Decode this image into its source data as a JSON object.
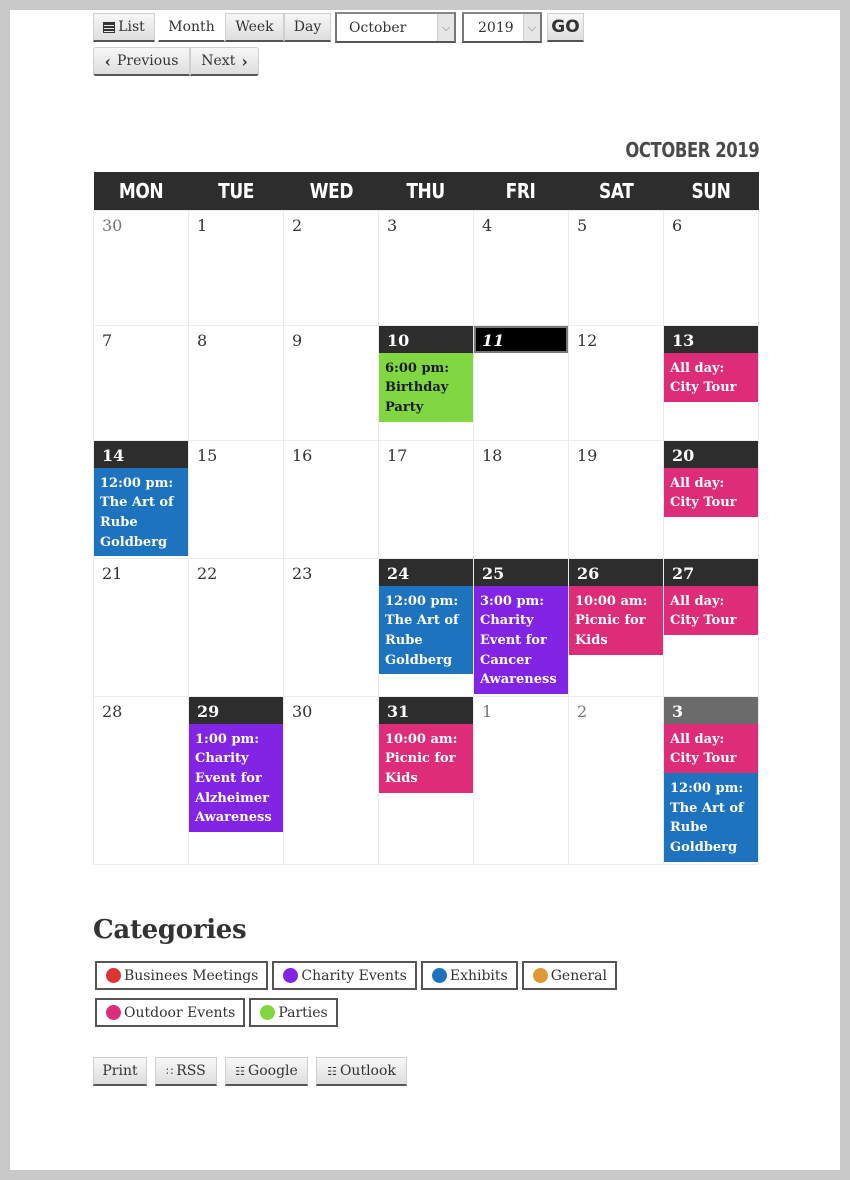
{
  "toolbar": {
    "views": [
      {
        "label": "List",
        "icon": "list-icon",
        "active": false
      },
      {
        "label": "Month",
        "active": true
      },
      {
        "label": "Week",
        "active": false
      },
      {
        "label": "Day",
        "active": false
      }
    ],
    "month_select": {
      "value": "October"
    },
    "year_select": {
      "value": "2019"
    },
    "go_label": "GO",
    "previous_label": "Previous",
    "next_label": "Next",
    "previous_icon": "‹",
    "next_icon": "›"
  },
  "calendar": {
    "title": "OCTOBER 2019",
    "weekdays": [
      "MON",
      "TUE",
      "WED",
      "THU",
      "FRI",
      "SAT",
      "SUN"
    ],
    "today": "11",
    "weeks": [
      [
        {
          "day": "30",
          "other": true,
          "events": []
        },
        {
          "day": "1",
          "events": []
        },
        {
          "day": "2",
          "events": []
        },
        {
          "day": "3",
          "events": []
        },
        {
          "day": "4",
          "events": []
        },
        {
          "day": "5",
          "events": []
        },
        {
          "day": "6",
          "events": []
        }
      ],
      [
        {
          "day": "7",
          "events": []
        },
        {
          "day": "8",
          "events": []
        },
        {
          "day": "9",
          "events": []
        },
        {
          "day": "10",
          "events": [
            {
              "text": "6:00 pm: Birthday Party",
              "category": "parties"
            }
          ]
        },
        {
          "day": "11",
          "today": true,
          "events": []
        },
        {
          "day": "12",
          "events": []
        },
        {
          "day": "13",
          "events": [
            {
              "text": "All day: City Tour",
              "category": "outdoor"
            }
          ]
        }
      ],
      [
        {
          "day": "14",
          "events": [
            {
              "text": "12:00 pm: The Art of Rube Goldberg",
              "category": "exhibits"
            }
          ]
        },
        {
          "day": "15",
          "events": []
        },
        {
          "day": "16",
          "events": []
        },
        {
          "day": "17",
          "events": []
        },
        {
          "day": "18",
          "events": []
        },
        {
          "day": "19",
          "events": []
        },
        {
          "day": "20",
          "events": [
            {
              "text": "All day: City Tour",
              "category": "outdoor"
            }
          ]
        }
      ],
      [
        {
          "day": "21",
          "events": []
        },
        {
          "day": "22",
          "events": []
        },
        {
          "day": "23",
          "events": []
        },
        {
          "day": "24",
          "events": [
            {
              "text": "12:00 pm: The Art of Rube Goldberg",
              "category": "exhibits"
            }
          ]
        },
        {
          "day": "25",
          "events": [
            {
              "text": "3:00 pm: Charity Event for Cancer Awareness",
              "category": "charity"
            }
          ]
        },
        {
          "day": "26",
          "events": [
            {
              "text": "10:00 am: Picnic for Kids",
              "category": "outdoor"
            }
          ]
        },
        {
          "day": "27",
          "events": [
            {
              "text": "All day: City Tour",
              "category": "outdoor"
            }
          ]
        }
      ],
      [
        {
          "day": "28",
          "events": []
        },
        {
          "day": "29",
          "events": [
            {
              "text": "1:00 pm: Charity Event for Alzheimer Awareness",
              "category": "charity"
            }
          ]
        },
        {
          "day": "30",
          "events": []
        },
        {
          "day": "31",
          "events": [
            {
              "text": "10:00 am: Picnic for Kids",
              "category": "outdoor"
            }
          ]
        },
        {
          "day": "1",
          "other": true,
          "events": []
        },
        {
          "day": "2",
          "other": true,
          "events": []
        },
        {
          "day": "3",
          "other": true,
          "events": [
            {
              "text": "All day: City Tour",
              "category": "outdoor"
            },
            {
              "text": "12:00 pm: The Art of Rube Goldberg",
              "category": "exhibits"
            }
          ]
        }
      ]
    ]
  },
  "categories": {
    "title": "Categories",
    "items": [
      {
        "key": "business",
        "label": "Businees Meetings",
        "color": "#dd3333"
      },
      {
        "key": "charity",
        "label": "Charity Events",
        "color": "#8224e3"
      },
      {
        "key": "exhibits",
        "label": "Exhibits",
        "color": "#1e73be"
      },
      {
        "key": "general",
        "label": "General",
        "color": "#dd9933"
      },
      {
        "key": "outdoor",
        "label": "Outdoor Events",
        "color": "#dd2d79"
      },
      {
        "key": "parties",
        "label": "Parties",
        "color": "#81d742"
      }
    ]
  },
  "export": {
    "print_label": "Print",
    "rss_label": "RSS",
    "google_label": "Google",
    "outlook_label": "Outlook"
  }
}
